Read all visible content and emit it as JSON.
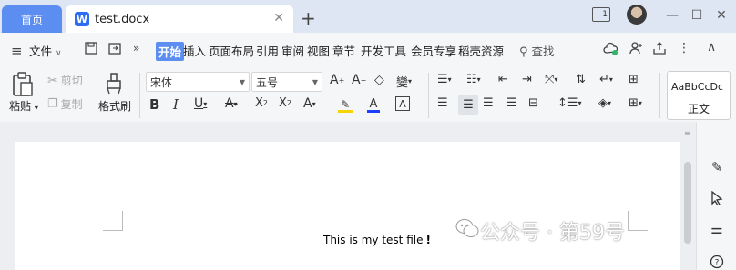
{
  "tabs": {
    "home_label": "首页",
    "doc_label": "test.docx",
    "doc_icon_letter": "W"
  },
  "window": {
    "page_indicator": "1"
  },
  "menu": {
    "file_label": "文件",
    "items": [
      "开始",
      "插入",
      "页面布局",
      "引用",
      "审阅",
      "视图",
      "章节",
      "开发工具",
      "会员专享",
      "稻壳资源"
    ],
    "search_label": "查找"
  },
  "ribbon": {
    "paste_label": "粘贴",
    "cut_label": "剪切",
    "copy_label": "复制",
    "format_painter_label": "格式刷",
    "font_name": "宋体",
    "font_size": "五号",
    "style_sample": "AaBbCcDc",
    "style_name": "正文",
    "colors": {
      "font_color": "#1f3fff",
      "highlight": "#f5d400"
    }
  },
  "document": {
    "text": "This is my test file",
    "cursor_char": "!"
  },
  "watermark": {
    "text": "公众号 · 第59号"
  }
}
